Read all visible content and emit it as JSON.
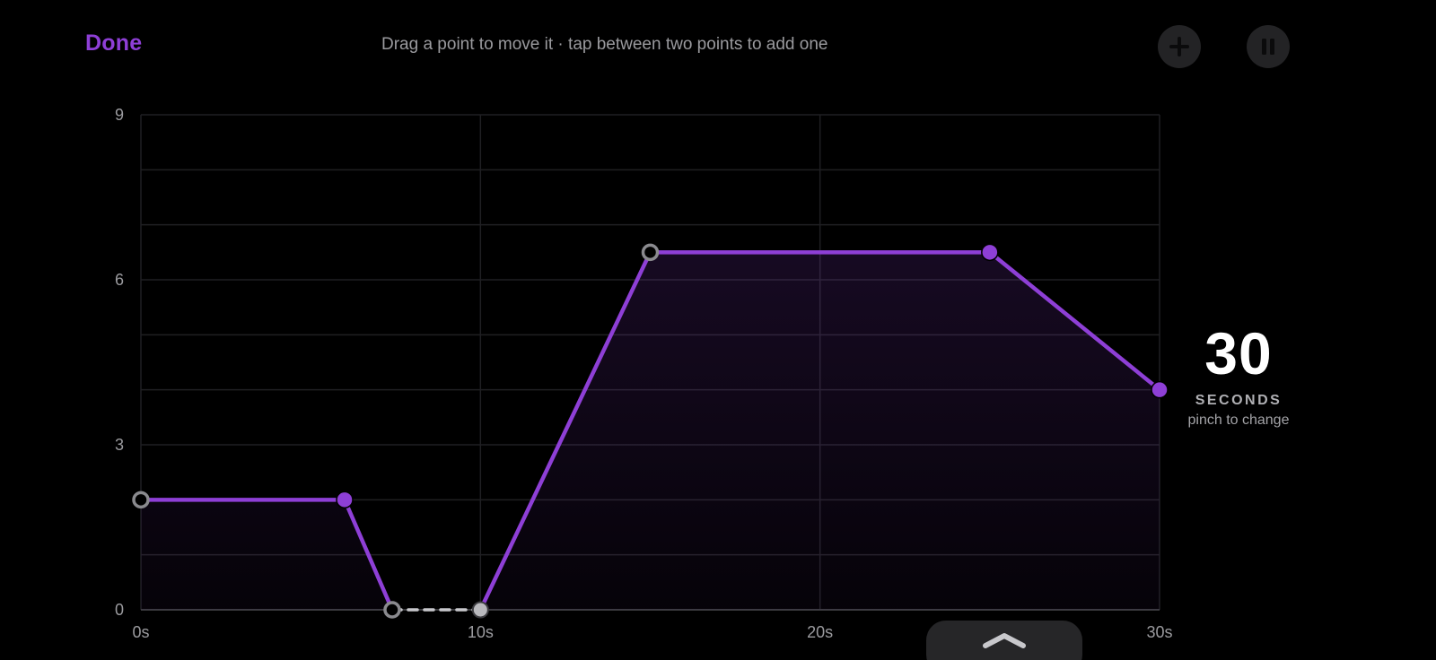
{
  "header": {
    "done_label": "Done",
    "hint": "Drag a point to move it · tap between two points to add one",
    "add_icon": "plus-icon",
    "pause_icon": "pause-icon"
  },
  "duration": {
    "value": "30",
    "unit": "SECONDS",
    "hint": "pinch to change"
  },
  "drawer": {
    "icon": "chevron-up-icon"
  },
  "colors": {
    "accent": "#8e3fd6",
    "background": "#000000",
    "grid": "#1f1f22",
    "muted_point": "#8a8a8e"
  },
  "chart_data": {
    "type": "line",
    "x_ticks": [
      "0s",
      "10s",
      "20s",
      "30s"
    ],
    "y_ticks": [
      "0",
      "3",
      "6",
      "9"
    ],
    "xlim": [
      0,
      30
    ],
    "ylim": [
      0,
      9
    ],
    "grid": true,
    "points": [
      {
        "x": 0,
        "y": 2,
        "style": "hollow"
      },
      {
        "x": 6,
        "y": 2,
        "style": "filled"
      },
      {
        "x": 7.4,
        "y": 0,
        "style": "hollow"
      },
      {
        "x": 10,
        "y": 0,
        "style": "muted"
      },
      {
        "x": 15,
        "y": 6.5,
        "style": "hollow"
      },
      {
        "x": 25,
        "y": 6.5,
        "style": "filled"
      },
      {
        "x": 30,
        "y": 4,
        "style": "filled"
      }
    ],
    "dashed_segments": [
      [
        2,
        3
      ]
    ]
  }
}
